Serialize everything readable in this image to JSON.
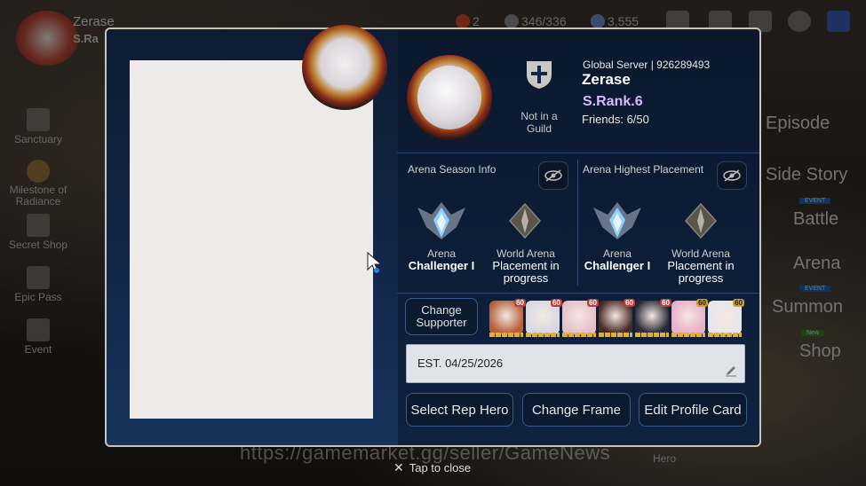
{
  "topbar": {
    "player_name": "Zerase",
    "player_rank": "S.Ra",
    "resources": [
      {
        "value": "2",
        "icon": "energy-icon"
      },
      {
        "value": "346/336",
        "icon": "stamina-icon"
      },
      {
        "value": "3,555",
        "icon": "crystal-icon"
      }
    ]
  },
  "left_menu": [
    {
      "label": "Sanctuary",
      "icon": "castle-icon"
    },
    {
      "label": "Milestone of Radiance",
      "icon": "sun-icon"
    },
    {
      "label": "Secret Shop",
      "icon": "question-icon"
    },
    {
      "label": "Epic Pass",
      "icon": "pass-icon"
    },
    {
      "label": "Event",
      "icon": "calendar-icon"
    }
  ],
  "right_menu": [
    {
      "label": "Episode",
      "tag": ""
    },
    {
      "label": "Side Story",
      "tag": "EVENT"
    },
    {
      "label": "Battle",
      "tag": ""
    },
    {
      "label": "Arena",
      "tag": "EVENT"
    },
    {
      "label": "Summon",
      "tag": "New"
    },
    {
      "label": "Shop",
      "tag": ""
    }
  ],
  "bottom": {
    "hero_label": "Hero"
  },
  "profile": {
    "server": "Global Server | 926289493",
    "name": "Zerase",
    "srank": "S.Rank.6",
    "friends": "Friends: 6/50",
    "guild_status": "Not in a Guild"
  },
  "arena_season": {
    "title": "Arena Season Info",
    "arena_label": "Arena",
    "arena_value": "Challenger I",
    "world_label": "World Arena",
    "world_value": "Placement in progress"
  },
  "arena_highest": {
    "title": "Arena Highest Placement",
    "arena_label": "Arena",
    "arena_value": "Challenger I",
    "world_label": "World Arena",
    "world_value": "Placement in progress"
  },
  "supporter": {
    "button_label": "Change Supporter",
    "heroes": [
      {
        "level": "60",
        "color": "#b8603a"
      },
      {
        "level": "60",
        "color": "#d8d8e0"
      },
      {
        "level": "60",
        "color": "#e6c0c8"
      },
      {
        "level": "60",
        "color": "#4a2a24"
      },
      {
        "level": "60",
        "color": "#2a2a34"
      },
      {
        "level": "60",
        "color": "#e8b0c8"
      },
      {
        "level": "60",
        "color": "#e6e6ea"
      }
    ]
  },
  "intro_text": "EST. 04/25/2026",
  "buttons": {
    "rep_hero": "Select Rep Hero",
    "frame": "Change Frame",
    "profile_card": "Edit Profile Card"
  },
  "tap_close": "Tap to close",
  "watermark": "https://gamemarket.gg/seller/GameNews",
  "colors": {
    "accent_srank": "#d9b8ff",
    "modal_bg": "#12284a"
  }
}
